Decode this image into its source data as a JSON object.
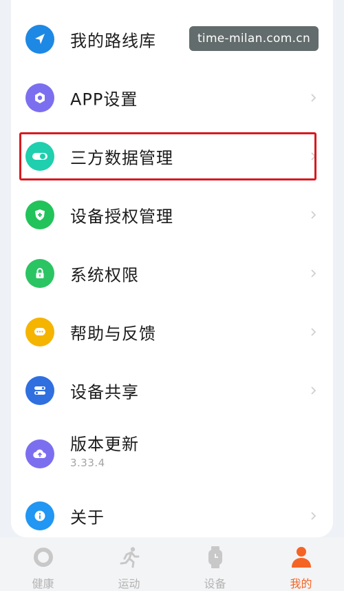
{
  "menu": {
    "items": [
      {
        "label": "我的路线库",
        "icon": "navigation-arrow-icon",
        "color": "#1e88e5"
      },
      {
        "label": "APP设置",
        "icon": "hexagon-settings-icon",
        "color": "#7b6ff0"
      },
      {
        "label": "三方数据管理",
        "icon": "toggle-icon",
        "color": "#1fcfae"
      },
      {
        "label": "设备授权管理",
        "icon": "shield-plus-icon",
        "color": "#22c35a"
      },
      {
        "label": "系统权限",
        "icon": "lock-icon",
        "color": "#2bc463"
      },
      {
        "label": "帮助与反馈",
        "icon": "chat-bubble-icon",
        "color": "#f5b400"
      },
      {
        "label": "设备共享",
        "icon": "sliders-icon",
        "color": "#2f6fe0"
      },
      {
        "label": "版本更新",
        "sub": "3.33.4",
        "icon": "cloud-upload-icon",
        "color": "#7b6ff0"
      },
      {
        "label": "关于",
        "icon": "info-icon",
        "color": "#2196f3"
      }
    ]
  },
  "watermark": "time-milan.com.cn",
  "tabs": [
    {
      "label": "健康",
      "icon": "ring-icon",
      "active": false
    },
    {
      "label": "运动",
      "icon": "runner-icon",
      "active": false
    },
    {
      "label": "设备",
      "icon": "watch-icon",
      "active": false
    },
    {
      "label": "我的",
      "icon": "person-icon",
      "active": true
    }
  ],
  "colors": {
    "accent": "#f46425",
    "highlight_border": "#d71920"
  }
}
